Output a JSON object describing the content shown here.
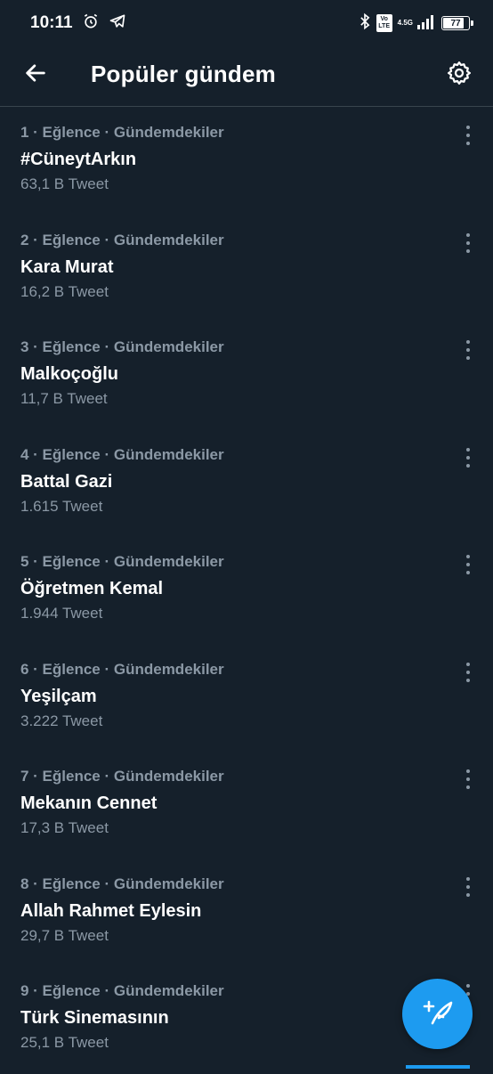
{
  "status_bar": {
    "time": "10:11",
    "lte_top": "Vo",
    "lte_bottom": "LTE",
    "network": "4.5G",
    "battery": "77"
  },
  "header": {
    "title": "Popüler gündem"
  },
  "trends": [
    {
      "meta": "1 · Eğlence · Gündemdekiler",
      "name": "#CüneytArkın",
      "count": "63,1 B Tweet"
    },
    {
      "meta": "2 · Eğlence · Gündemdekiler",
      "name": "Kara Murat",
      "count": "16,2 B Tweet"
    },
    {
      "meta": "3 · Eğlence · Gündemdekiler",
      "name": "Malkoçoğlu",
      "count": "11,7 B Tweet"
    },
    {
      "meta": "4 · Eğlence · Gündemdekiler",
      "name": "Battal Gazi",
      "count": "1.615 Tweet"
    },
    {
      "meta": "5 · Eğlence · Gündemdekiler",
      "name": "Öğretmen Kemal",
      "count": "1.944 Tweet"
    },
    {
      "meta": "6 · Eğlence · Gündemdekiler",
      "name": "Yeşilçam",
      "count": "3.222 Tweet"
    },
    {
      "meta": "7 · Eğlence · Gündemdekiler",
      "name": "Mekanın Cennet",
      "count": "17,3 B Tweet"
    },
    {
      "meta": "8 · Eğlence · Gündemdekiler",
      "name": "Allah Rahmet Eylesin",
      "count": "29,7 B Tweet"
    },
    {
      "meta": "9 · Eğlence · Gündemdekiler",
      "name": "Türk Sinemasının",
      "count": "25,1 B Tweet"
    }
  ],
  "icons": {
    "back": "arrow-left-icon",
    "settings": "gear-icon",
    "more": "more-vertical-icon",
    "compose": "compose-tweet-icon"
  },
  "colors": {
    "background": "#15202b",
    "secondary_text": "#8b98a5",
    "accent": "#1d9bf0"
  }
}
